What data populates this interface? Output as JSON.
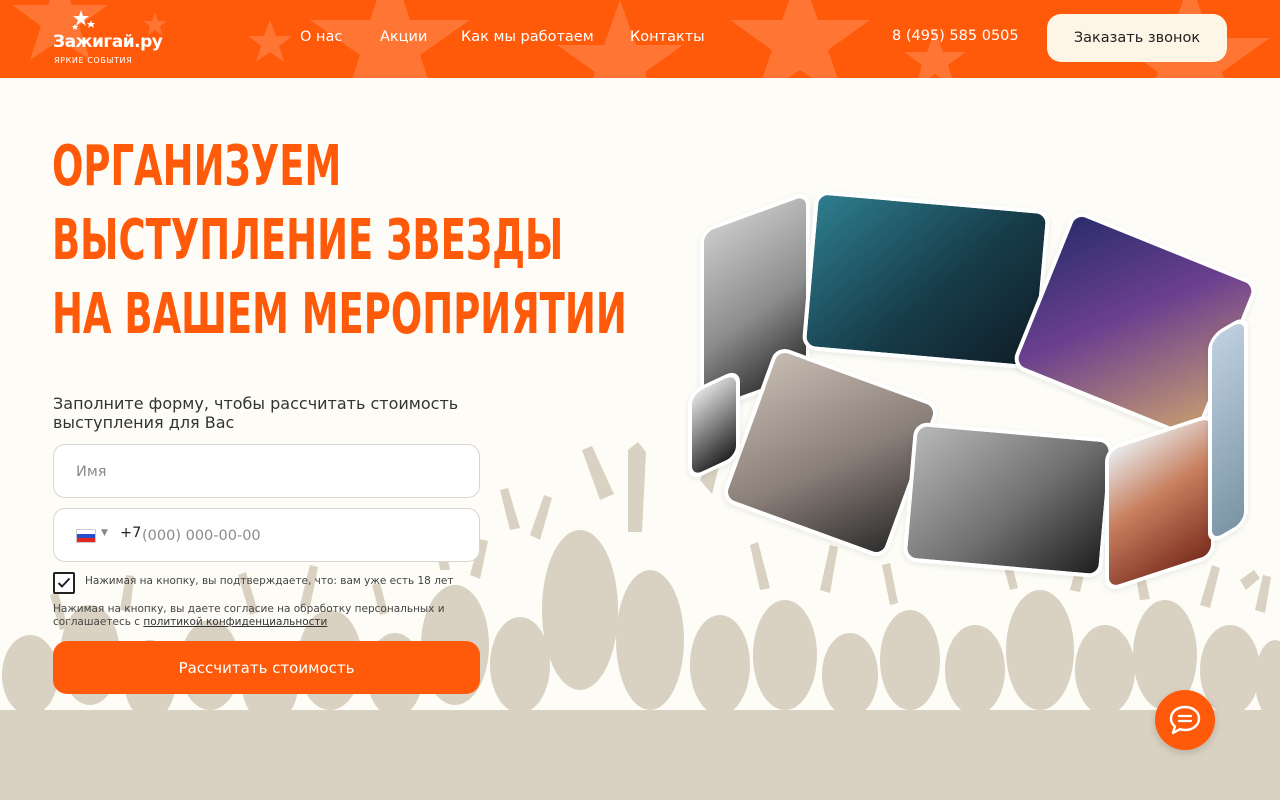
{
  "header": {
    "logo_text": "Зажигай.ру",
    "logo_sub": "ЯРКИЕ СОБЫТИЯ",
    "nav": [
      "О нас",
      "Акции",
      "Как мы работаем",
      "Контакты"
    ],
    "phone": "8 (495) 585 0505",
    "callback_label": "Заказать звонок"
  },
  "hero": {
    "title_lines": [
      "ОРГАНИЗУЕМ",
      "ВЫСТУПЛЕНИЕ ЗВЕЗДЫ",
      "НА ВАШЕМ МЕРОПРИЯТИИ"
    ]
  },
  "form": {
    "caption": "Заполните форму, чтобы рассчитать стоимость выступления для Вас",
    "name_placeholder": "Имя",
    "phone_prefix": "+7",
    "phone_placeholder": "(000) 000-00-00",
    "age_confirm": "Нажимая на кнопку, вы подтверждаете, что: вам уже есть 18 лет",
    "consent_text": "Нажимая на кнопку, вы даете согласие на обработку персональных и соглашаетесь с",
    "privacy_link": "политикой конфиденциальности",
    "submit_label": "Рассчитать стоимость"
  },
  "colors": {
    "accent": "#ff5a0a",
    "background": "#fdfcf6",
    "crowd": "#d9d1c1",
    "callback_bg": "#fdf6e6"
  },
  "icons": {
    "chat": "chat-bubble-icon",
    "check": "checkmark-icon",
    "flag": "russia-flag-icon"
  }
}
